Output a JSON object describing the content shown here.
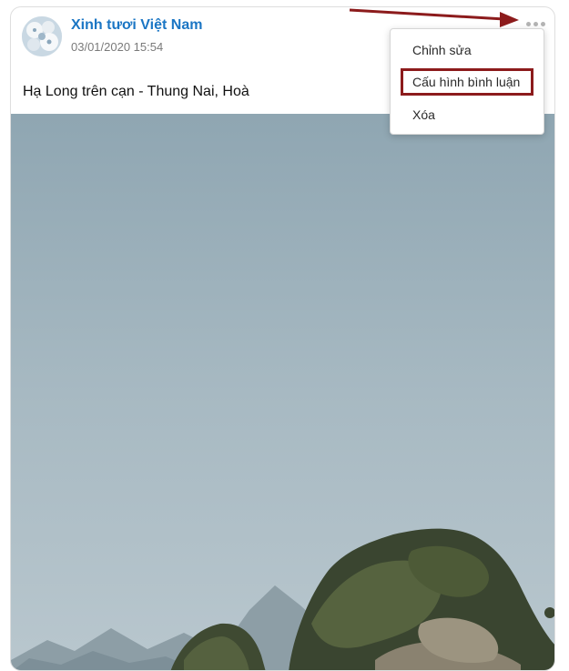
{
  "post": {
    "page_name": "Xinh tươi Việt Nam",
    "timestamp": "03/01/2020 15:54",
    "caption": "Hạ Long trên cạn - Thung Nai, Hoà"
  },
  "menu": {
    "items": [
      {
        "label": "Chỉnh sửa"
      },
      {
        "label": "Cấu hình bình luận"
      },
      {
        "label": "Xóa"
      }
    ],
    "highlighted_item": "Cấu hình bình luận"
  },
  "colors": {
    "page_name": "#1b76c4",
    "annotation": "#8c1b1c",
    "timestamp": "#7a7a7a"
  },
  "icons": {
    "more": "more-horizontal-icon",
    "avatar": "flower-avatar"
  }
}
